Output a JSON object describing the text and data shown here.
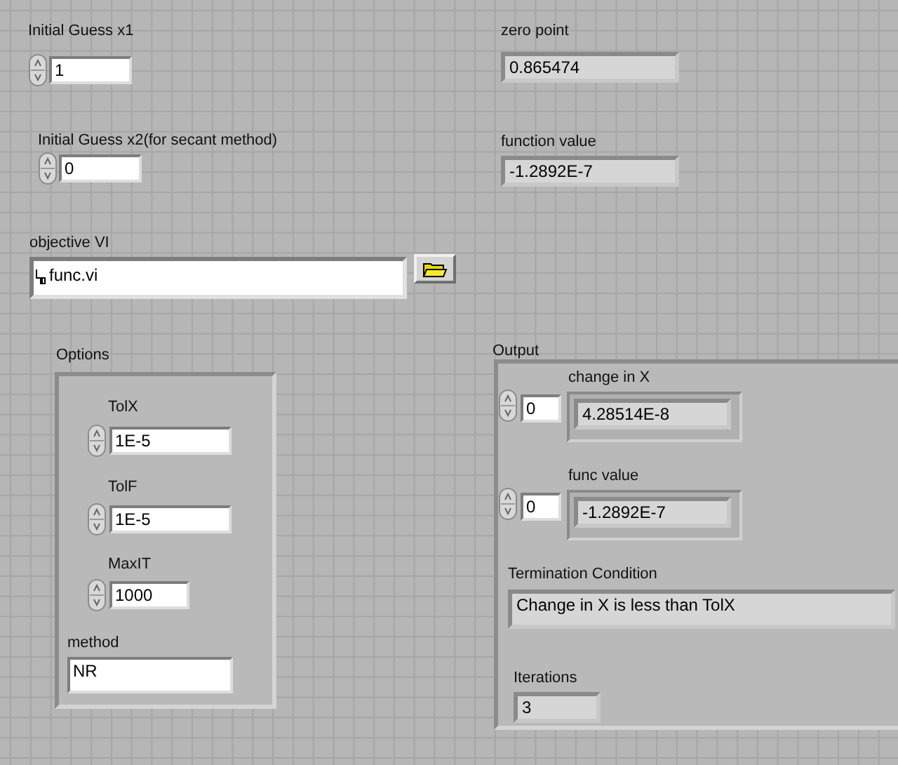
{
  "inputs": [
    {
      "label": "Initial Guess x1",
      "value": "1"
    },
    {
      "label": "Initial Guess x2(for secant method)",
      "value": "0"
    }
  ],
  "objective_vi": {
    "label": "objective VI",
    "value": "func.vi"
  },
  "results": [
    {
      "label": "zero point",
      "value": "0.865474"
    },
    {
      "label": "function  value",
      "value": "-1.2892E-7"
    }
  ],
  "options": {
    "label": "Options",
    "fields": [
      {
        "kind": "numeric",
        "label": "TolX",
        "value": "1E-5"
      },
      {
        "kind": "numeric",
        "label": "TolF",
        "value": "1E-5"
      },
      {
        "kind": "numeric",
        "label": "MaxIT",
        "value": "1000"
      },
      {
        "kind": "text",
        "label": "method",
        "value": "NR"
      }
    ]
  },
  "output": {
    "label": "Output",
    "arrays": [
      {
        "label": "change in X",
        "index": "0",
        "value": "4.28514E-8"
      },
      {
        "label": "func value",
        "index": "0",
        "value": "-1.2892E-7"
      }
    ],
    "termination": {
      "label": "Termination Condition",
      "value": "Change in X is less than TolX"
    },
    "iterations": {
      "label": "Iterations",
      "value": "3"
    }
  }
}
